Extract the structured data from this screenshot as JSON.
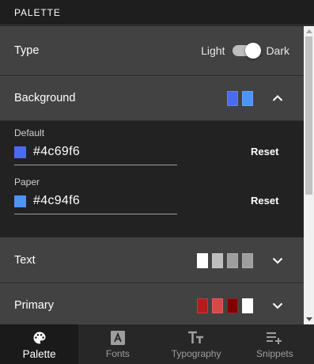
{
  "header": {
    "title": "PALETTE"
  },
  "type_row": {
    "label": "Type",
    "light": "Light",
    "dark": "Dark",
    "mode": "dark"
  },
  "background": {
    "label": "Background",
    "swatches": [
      "#4c69f6",
      "#4c94f6"
    ],
    "default": {
      "label": "Default",
      "value": "#4c69f6",
      "reset": "Reset"
    },
    "paper": {
      "label": "Paper",
      "value": "#4c94f6",
      "reset": "Reset"
    }
  },
  "text": {
    "label": "Text",
    "swatches": [
      "#ffffff",
      "#bdbdbd",
      "#9e9e9e",
      "#9e9e9e"
    ]
  },
  "primary": {
    "label": "Primary",
    "swatches": [
      "#b71c1c",
      "#d84848",
      "#7f0000",
      "#ffffff"
    ]
  },
  "nav": {
    "items": [
      {
        "label": "Palette",
        "icon": "palette-icon",
        "active": true
      },
      {
        "label": "Fonts",
        "icon": "font-icon",
        "active": false
      },
      {
        "label": "Typography",
        "icon": "text-fields-icon",
        "active": false
      },
      {
        "label": "Snippets",
        "icon": "playlist-add-icon",
        "active": false
      }
    ]
  }
}
